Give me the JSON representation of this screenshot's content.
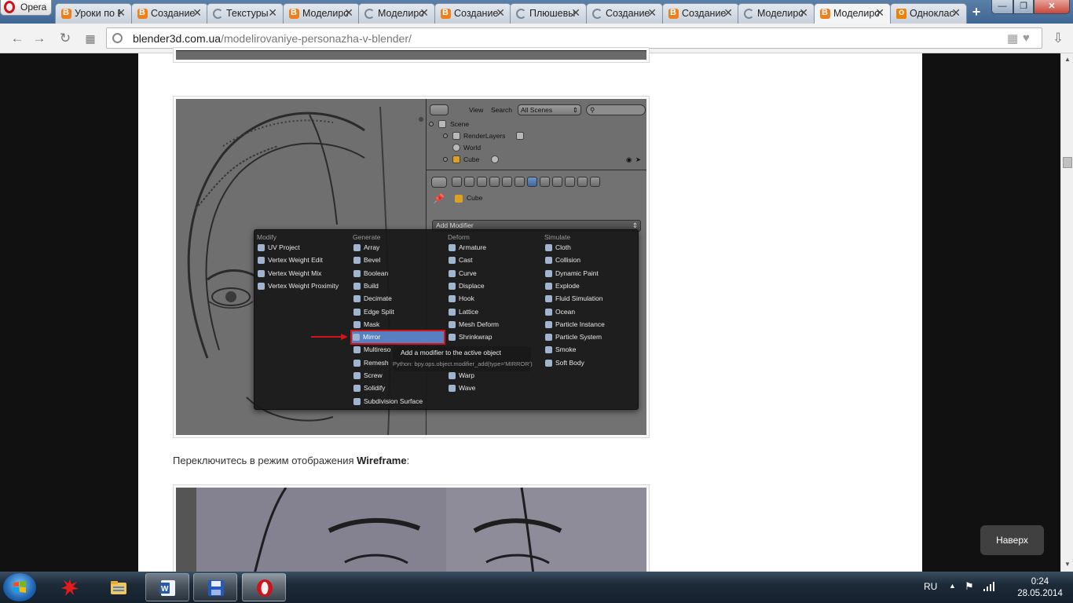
{
  "browser": {
    "menu_label": "Opera",
    "tabs": [
      {
        "label": "Уроки по Blender",
        "icon": "blender-favicon"
      },
      {
        "label": "Создание персонажа",
        "icon": "blender-favicon"
      },
      {
        "label": "Текстуры",
        "icon": "loading-spinner-icon"
      },
      {
        "label": "Моделирование",
        "icon": "blender-favicon"
      },
      {
        "label": "Моделирование",
        "icon": "loading-spinner-icon"
      },
      {
        "label": "Создание",
        "icon": "blender-favicon"
      },
      {
        "label": "Плюшевый",
        "icon": "loading-spinner-icon"
      },
      {
        "label": "Создание",
        "icon": "loading-spinner-icon"
      },
      {
        "label": "Создание",
        "icon": "blender-favicon"
      },
      {
        "label": "Моделирование",
        "icon": "loading-spinner-icon"
      },
      {
        "label": "Моделирование персонажа",
        "icon": "blender-favicon"
      },
      {
        "label": "Одноклассники",
        "icon": "odnoklassniki-favicon"
      }
    ],
    "active_tab_index": 10,
    "address": {
      "host": "blender3d.com.ua",
      "path": "/modelirovaniye-personazha-v-blender/"
    }
  },
  "blender": {
    "outliner": {
      "view": "View",
      "search": "Search",
      "scene_select": "All Scenes",
      "rows": [
        "Scene",
        "RenderLayers",
        "World",
        "Cube"
      ]
    },
    "properties": {
      "object_name": "Cube",
      "add_modifier": "Add Modifier"
    },
    "menu": {
      "columns": [
        {
          "heading": "Modify",
          "items": [
            "UV Project",
            "Vertex Weight Edit",
            "Vertex Weight Mix",
            "Vertex Weight Proximity"
          ]
        },
        {
          "heading": "Generate",
          "items": [
            "Array",
            "Bevel",
            "Boolean",
            "Build",
            "Decimate",
            "Edge Split",
            "Mask",
            "Mirror",
            "Multireso",
            "Remesh",
            "Screw",
            "Solidify",
            "Subdivision Surface"
          ]
        },
        {
          "heading": "Deform",
          "items": [
            "Armature",
            "Cast",
            "Curve",
            "Displace",
            "Hook",
            "Lattice",
            "Mesh Deform",
            "Shrinkwrap",
            "",
            "",
            "Warp",
            "Wave"
          ]
        },
        {
          "heading": "Simulate",
          "items": [
            "Cloth",
            "Collision",
            "Dynamic Paint",
            "Explode",
            "Fluid Simulation",
            "Ocean",
            "Particle Instance",
            "Particle System",
            "Smoke",
            "Soft Body"
          ]
        }
      ],
      "highlighted": "Mirror",
      "tooltip": {
        "title": "Add a modifier to the active object",
        "python": "Python: bpy.ops.object.modifier_add(type='MIRROR')"
      }
    }
  },
  "content": {
    "paragraph_prefix": "Переключитесь в режим отображения ",
    "paragraph_bold": "Wireframe",
    "paragraph_suffix": ":",
    "scroll_top": "Наверх"
  },
  "taskbar": {
    "apps": [
      "red-splat-app-icon",
      "file-explorer-icon",
      "word-icon",
      "floppy-save-icon",
      "opera-icon"
    ],
    "language": "RU",
    "time": "0:24",
    "date": "28.05.2014"
  },
  "colors": {
    "menu_highlight": "#5680c2",
    "callout_red": "#d3141a",
    "opera_red": "#d0121c"
  }
}
